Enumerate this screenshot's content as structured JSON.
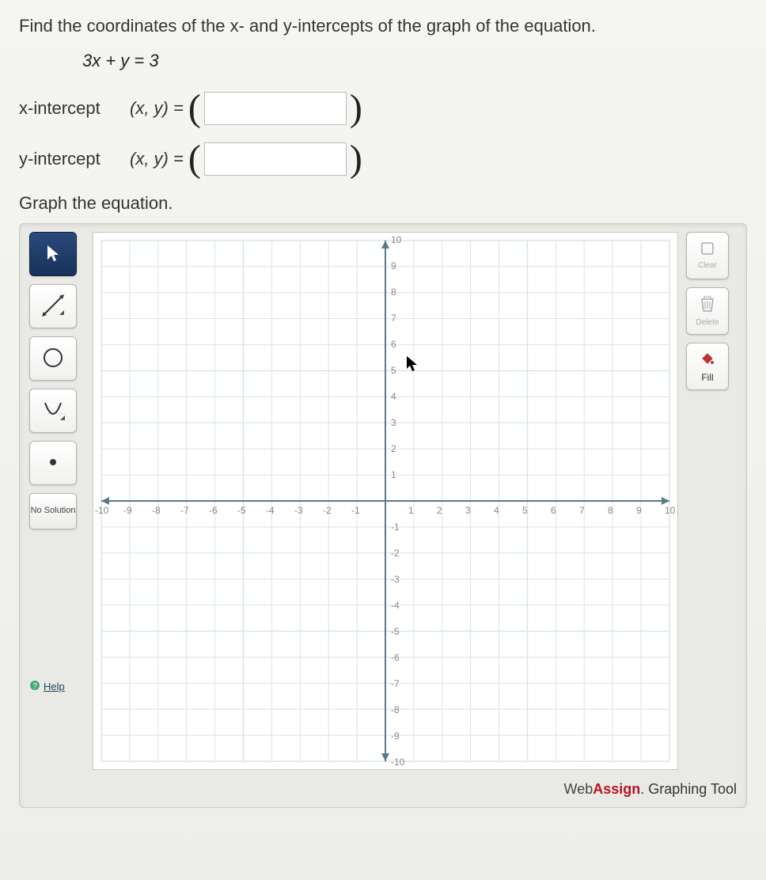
{
  "question": {
    "prompt": "Find the coordinates of the x- and y-intercepts of the graph of the equation.",
    "equation": "3x + y = 3",
    "x_intercept_label": "x-intercept",
    "y_intercept_label": "y-intercept",
    "xy_expr": "(x, y) = ",
    "graph_heading": "Graph the equation."
  },
  "toolbar_left": {
    "pointer": "pointer",
    "line": "line",
    "circle": "circle",
    "region": "region",
    "point": "point",
    "no_solution": "No Solution",
    "help": "Help"
  },
  "toolbar_right": {
    "clear": "Clear",
    "delete": "Delete",
    "fill": "Fill"
  },
  "branding": {
    "web": "Web",
    "assign": "Assign",
    "suffix": ". Graphing Tool"
  },
  "chart_data": {
    "type": "scatter",
    "title": "",
    "xlabel": "",
    "ylabel": "",
    "xlim": [
      -10,
      10
    ],
    "ylim": [
      -10,
      10
    ],
    "x_ticks": [
      -10,
      -9,
      -8,
      -7,
      -6,
      -5,
      -4,
      -3,
      -2,
      -1,
      1,
      2,
      3,
      4,
      5,
      6,
      7,
      8,
      9,
      10
    ],
    "y_ticks": [
      -10,
      -9,
      -8,
      -7,
      -6,
      -5,
      -4,
      -3,
      -2,
      -1,
      1,
      2,
      3,
      4,
      5,
      6,
      7,
      8,
      9,
      10
    ],
    "series": []
  }
}
